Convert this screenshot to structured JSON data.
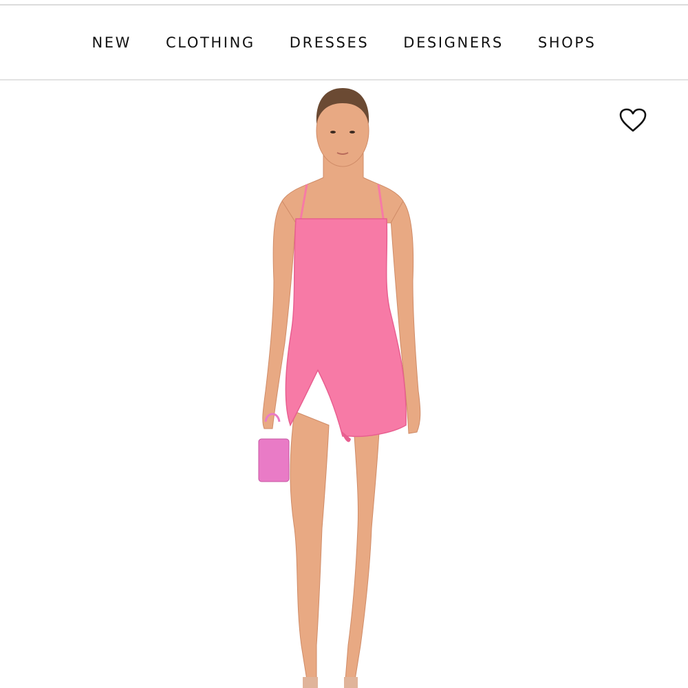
{
  "nav": {
    "items": [
      {
        "label": "NEW"
      },
      {
        "label": "CLOTHING"
      },
      {
        "label": "DRESSES"
      },
      {
        "label": "DESIGNERS"
      },
      {
        "label": "SHOPS"
      }
    ]
  },
  "product": {
    "wishlist_icon": "heart-outline-icon",
    "image": "model-in-pink-mini-dress",
    "colors": {
      "dress": "#f77aa6",
      "dress_shade": "#e85f90",
      "skin": "#e8a983",
      "skin_shade": "#cf8b67",
      "hair": "#6b4a33",
      "bag": "#e97bc6"
    }
  }
}
